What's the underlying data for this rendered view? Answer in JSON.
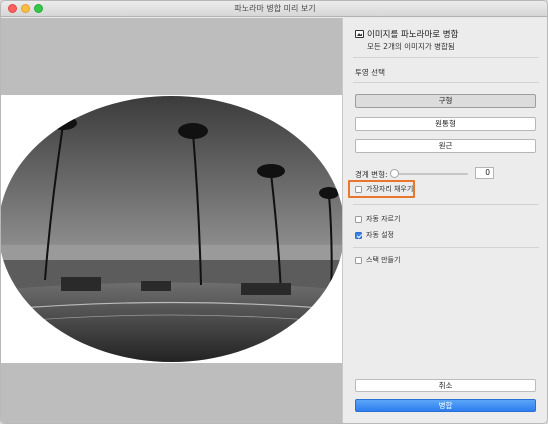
{
  "window": {
    "title": "파노라마 병합 미리 보기"
  },
  "panel": {
    "header": {
      "title": "이미지를 파노라마로 병합",
      "subtitle": "모든 2개의 이미지가 병합됨"
    },
    "projection": {
      "label": "투영 선택",
      "options": [
        "구형",
        "원통형",
        "원근"
      ],
      "selected": "구형"
    },
    "boundary_warp": {
      "label": "경계 변형:",
      "value": "0",
      "level": 0
    },
    "fill_edges": {
      "label": "가장자리 채우기",
      "checked": false
    },
    "auto_crop": {
      "label": "자동 자르기",
      "checked": false
    },
    "auto_settings": {
      "label": "자동 설정",
      "checked": true
    },
    "create_stack": {
      "label": "스택 만들기",
      "checked": false
    },
    "buttons": {
      "cancel": "취소",
      "merge": "병합"
    }
  },
  "colors": {
    "accent": "#2d7df0",
    "highlight": "#e8772e"
  }
}
